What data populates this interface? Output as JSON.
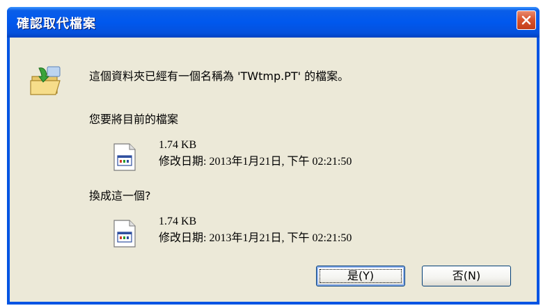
{
  "window": {
    "title": "確認取代檔案"
  },
  "dialog": {
    "message": "這個資料夾已經有一個名稱為 'TWtmp.PT' 的檔案。",
    "replace_prompt": "您要將目前的檔案",
    "with_prompt": "換成這一個?",
    "existing_file": {
      "size": "1.74 KB",
      "modified_label": "修改日期:",
      "modified_value": "2013年1月21日, 下午 02:21:50"
    },
    "new_file": {
      "size": "1.74 KB",
      "modified_label": "修改日期:",
      "modified_value": "2013年1月21日, 下午 02:21:50"
    }
  },
  "buttons": {
    "yes": "是(Y)",
    "no": "否(N)"
  },
  "icons": {
    "close": "close-icon",
    "folder": "folder-replace-icon",
    "file": "file-icon"
  },
  "colors": {
    "titlebar": "#0058ee",
    "client_bg": "#ece9d8",
    "close_button": "#d8552f"
  }
}
